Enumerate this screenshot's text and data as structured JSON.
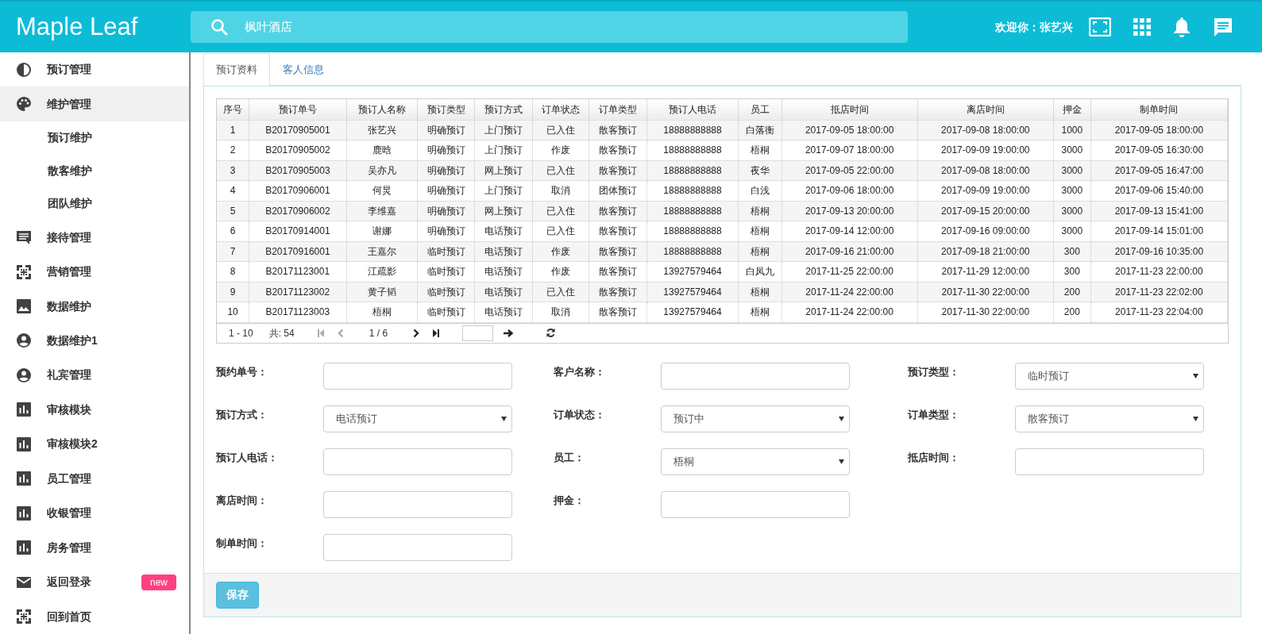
{
  "header": {
    "logo": "Maple Leaf",
    "search": {
      "value": "枫叶酒店"
    },
    "welcome": "欢迎你：张艺兴"
  },
  "sidebar": {
    "items": [
      {
        "label": "预订管理",
        "selected": false
      },
      {
        "label": "维护管理",
        "selected": true,
        "expanded": true,
        "children": [
          {
            "label": "预订维护"
          },
          {
            "label": "散客维护"
          },
          {
            "label": "团队维护"
          }
        ]
      },
      {
        "label": "接待管理",
        "selected": false
      },
      {
        "label": "营销管理",
        "selected": false
      },
      {
        "label": "数据维护",
        "selected": false
      },
      {
        "label": "数据维护1",
        "selected": false
      },
      {
        "label": "礼宾管理",
        "selected": false
      },
      {
        "label": "审核模块",
        "selected": false
      },
      {
        "label": "审核模块2",
        "selected": false
      },
      {
        "label": "员工管理",
        "selected": false
      },
      {
        "label": "收银管理",
        "selected": false
      },
      {
        "label": "房务管理",
        "selected": false
      },
      {
        "label": "返回登录",
        "selected": false,
        "badge": "new"
      },
      {
        "label": "回到首页",
        "selected": false
      }
    ]
  },
  "tabs": [
    {
      "label": "预订资料",
      "selected": true
    },
    {
      "label": "客人信息",
      "selected": false
    }
  ],
  "table": {
    "columns": [
      "序号",
      "预订单号",
      "预订人名称",
      "预订类型",
      "预订方式",
      "订单状态",
      "订单类型",
      "预订人电话",
      "员工",
      "抵店时间",
      "离店时间",
      "押金",
      "制单时间"
    ],
    "rows": [
      [
        "1",
        "B20170905001",
        "张艺兴",
        "明确预订",
        "上门预订",
        "已入住",
        "散客预订",
        "18888888888",
        "白落衡",
        "2017-09-05 18:00:00",
        "2017-09-08 18:00:00",
        "1000",
        "2017-09-05 18:00:00"
      ],
      [
        "2",
        "B20170905002",
        "鹿晗",
        "明确预订",
        "上门预订",
        "作废",
        "散客预订",
        "18888888888",
        "梧桐",
        "2017-09-07 18:00:00",
        "2017-09-09 19:00:00",
        "3000",
        "2017-09-05 16:30:00"
      ],
      [
        "3",
        "B20170905003",
        "吴亦凡",
        "明确预订",
        "网上预订",
        "已入住",
        "散客预订",
        "18888888888",
        "夜华",
        "2017-09-05 22:00:00",
        "2017-09-08 18:00:00",
        "3000",
        "2017-09-05 16:47:00"
      ],
      [
        "4",
        "B20170906001",
        "何炅",
        "明确预订",
        "上门预订",
        "取消",
        "团体预订",
        "18888888888",
        "白浅",
        "2017-09-06 18:00:00",
        "2017-09-09 19:00:00",
        "3000",
        "2017-09-06 15:40:00"
      ],
      [
        "5",
        "B20170906002",
        "李维嘉",
        "明确预订",
        "网上预订",
        "已入住",
        "散客预订",
        "18888888888",
        "梧桐",
        "2017-09-13 20:00:00",
        "2017-09-15 20:00:00",
        "3000",
        "2017-09-13 15:41:00"
      ],
      [
        "6",
        "B20170914001",
        "谢娜",
        "明确预订",
        "电话预订",
        "已入住",
        "散客预订",
        "18888888888",
        "梧桐",
        "2017-09-14 12:00:00",
        "2017-09-16 09:00:00",
        "3000",
        "2017-09-14 15:01:00"
      ],
      [
        "7",
        "B20170916001",
        "王嘉尔",
        "临时预订",
        "电话预订",
        "作废",
        "散客预订",
        "18888888888",
        "梧桐",
        "2017-09-16 21:00:00",
        "2017-09-18 21:00:00",
        "300",
        "2017-09-16 10:35:00"
      ],
      [
        "8",
        "B20171123001",
        "江疏影",
        "临时预订",
        "电话预订",
        "作废",
        "散客预订",
        "13927579464",
        "白凤九",
        "2017-11-25 22:00:00",
        "2017-11-29 12:00:00",
        "300",
        "2017-11-23 22:00:00"
      ],
      [
        "9",
        "B20171123002",
        "黄子韬",
        "临时预订",
        "电话预订",
        "已入住",
        "散客预订",
        "13927579464",
        "梧桐",
        "2017-11-24 22:00:00",
        "2017-11-30 22:00:00",
        "200",
        "2017-11-23 22:02:00"
      ],
      [
        "10",
        "B20171123003",
        "梧桐",
        "临时预订",
        "电话预订",
        "取消",
        "散客预订",
        "13927579464",
        "梧桐",
        "2017-11-24 22:00:00",
        "2017-11-30 22:00:00",
        "200",
        "2017-11-23 22:04:00"
      ]
    ],
    "pager": {
      "range": "1 - 10",
      "total": "共: 54",
      "page": "1 / 6"
    }
  },
  "form": {
    "fields": [
      {
        "label": "预约单号：",
        "kind": "text"
      },
      {
        "label": "客户名称：",
        "kind": "text"
      },
      {
        "label": "预订类型：",
        "kind": "select",
        "value": "临时预订"
      },
      {
        "label": "预订方式：",
        "kind": "select",
        "value": "电话预订"
      },
      {
        "label": "订单状态：",
        "kind": "select",
        "value": "预订中"
      },
      {
        "label": "订单类型：",
        "kind": "select",
        "value": "散客预订"
      },
      {
        "label": "预订人电话：",
        "kind": "text"
      },
      {
        "label": "员工：",
        "kind": "select",
        "value": "梧桐"
      },
      {
        "label": "抵店时间：",
        "kind": "text"
      },
      {
        "label": "离店时间：",
        "kind": "text"
      },
      {
        "label": "押金：",
        "kind": "text"
      },
      {
        "label": "制单时间：",
        "kind": "text"
      }
    ],
    "save_button": "保存"
  }
}
